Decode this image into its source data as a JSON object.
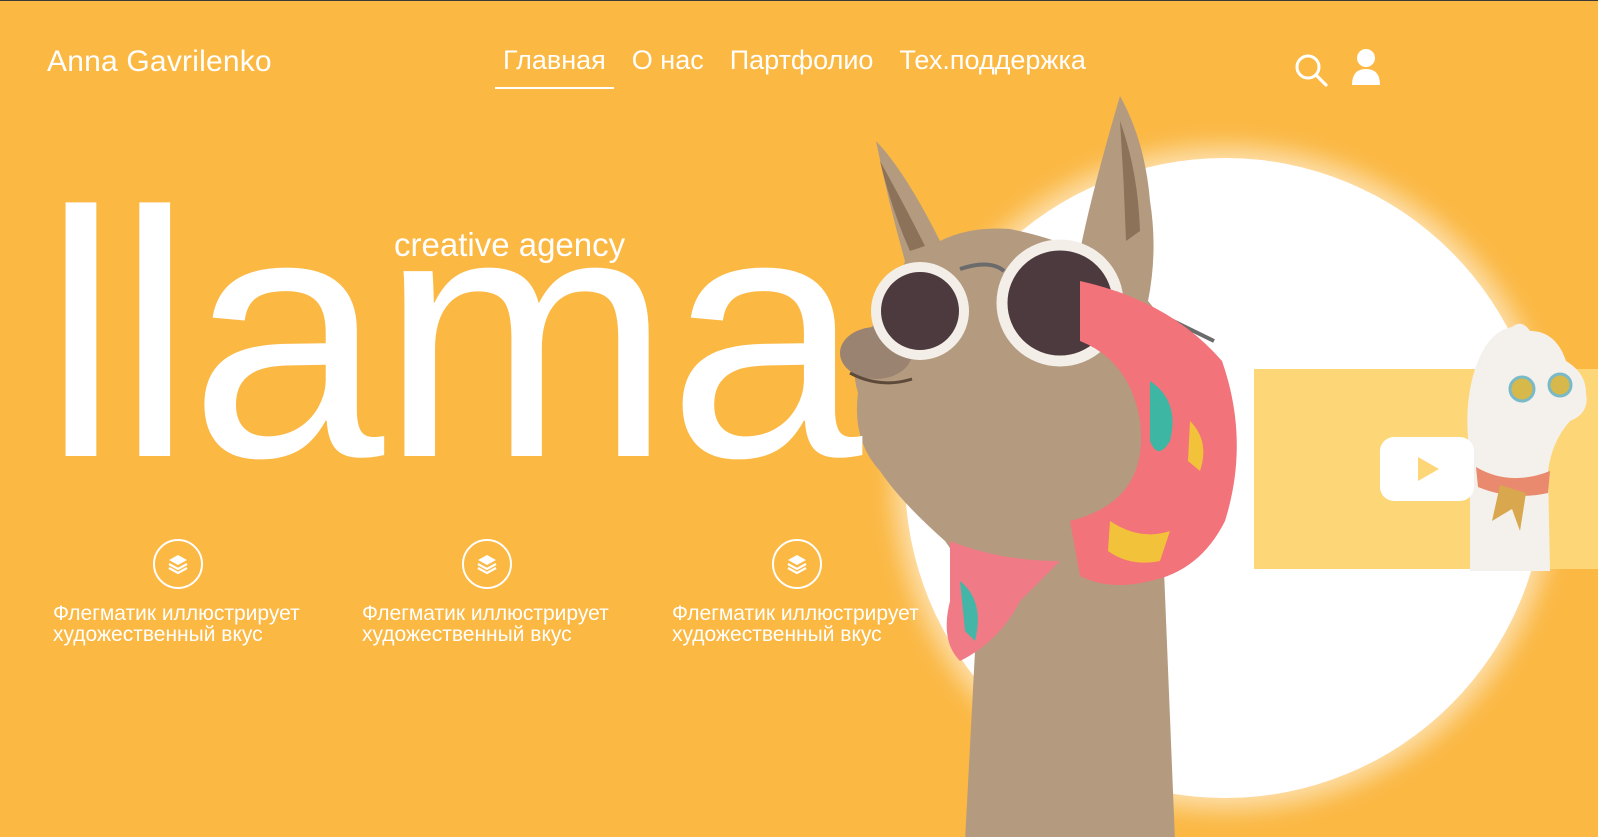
{
  "header": {
    "brand": "Anna Gavrilenko",
    "nav": [
      {
        "label": "Главная",
        "active": true
      },
      {
        "label": "О нас",
        "active": false
      },
      {
        "label": "Партфолио",
        "active": false
      },
      {
        "label": "Тех.поддержка",
        "active": false
      }
    ],
    "icons": [
      "search-icon",
      "user-icon"
    ]
  },
  "hero": {
    "title": "llama",
    "subtitle": "creative agency"
  },
  "features": [
    {
      "icon": "layers-icon",
      "text_line1": "Флегматик иллюстрирует",
      "text_line2": "художественный вкус"
    },
    {
      "icon": "layers-icon",
      "text_line1": "Флегматик иллюстрирует",
      "text_line2": "художественный вкус"
    },
    {
      "icon": "layers-icon",
      "text_line1": "Флегматик иллюстрирует",
      "text_line2": "художественный вкус"
    }
  ],
  "video": {
    "icon": "play-icon"
  },
  "colors": {
    "background": "#fbb843",
    "panel": "#fdd678",
    "text": "#ffffff"
  }
}
